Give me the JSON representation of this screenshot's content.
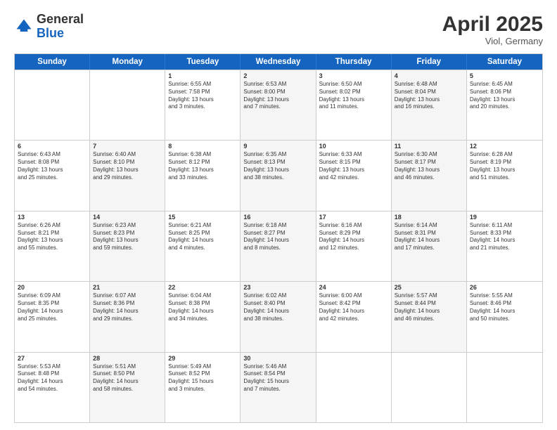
{
  "header": {
    "logo_general": "General",
    "logo_blue": "Blue",
    "title": "April 2025",
    "location": "Viol, Germany"
  },
  "days_of_week": [
    "Sunday",
    "Monday",
    "Tuesday",
    "Wednesday",
    "Thursday",
    "Friday",
    "Saturday"
  ],
  "weeks": [
    [
      {
        "day": "",
        "info": "",
        "shaded": false
      },
      {
        "day": "",
        "info": "",
        "shaded": false
      },
      {
        "day": "1",
        "info": "Sunrise: 6:55 AM\nSunset: 7:58 PM\nDaylight: 13 hours\nand 3 minutes.",
        "shaded": false
      },
      {
        "day": "2",
        "info": "Sunrise: 6:53 AM\nSunset: 8:00 PM\nDaylight: 13 hours\nand 7 minutes.",
        "shaded": true
      },
      {
        "day": "3",
        "info": "Sunrise: 6:50 AM\nSunset: 8:02 PM\nDaylight: 13 hours\nand 11 minutes.",
        "shaded": false
      },
      {
        "day": "4",
        "info": "Sunrise: 6:48 AM\nSunset: 8:04 PM\nDaylight: 13 hours\nand 16 minutes.",
        "shaded": true
      },
      {
        "day": "5",
        "info": "Sunrise: 6:45 AM\nSunset: 8:06 PM\nDaylight: 13 hours\nand 20 minutes.",
        "shaded": false
      }
    ],
    [
      {
        "day": "6",
        "info": "Sunrise: 6:43 AM\nSunset: 8:08 PM\nDaylight: 13 hours\nand 25 minutes.",
        "shaded": false
      },
      {
        "day": "7",
        "info": "Sunrise: 6:40 AM\nSunset: 8:10 PM\nDaylight: 13 hours\nand 29 minutes.",
        "shaded": true
      },
      {
        "day": "8",
        "info": "Sunrise: 6:38 AM\nSunset: 8:12 PM\nDaylight: 13 hours\nand 33 minutes.",
        "shaded": false
      },
      {
        "day": "9",
        "info": "Sunrise: 6:35 AM\nSunset: 8:13 PM\nDaylight: 13 hours\nand 38 minutes.",
        "shaded": true
      },
      {
        "day": "10",
        "info": "Sunrise: 6:33 AM\nSunset: 8:15 PM\nDaylight: 13 hours\nand 42 minutes.",
        "shaded": false
      },
      {
        "day": "11",
        "info": "Sunrise: 6:30 AM\nSunset: 8:17 PM\nDaylight: 13 hours\nand 46 minutes.",
        "shaded": true
      },
      {
        "day": "12",
        "info": "Sunrise: 6:28 AM\nSunset: 8:19 PM\nDaylight: 13 hours\nand 51 minutes.",
        "shaded": false
      }
    ],
    [
      {
        "day": "13",
        "info": "Sunrise: 6:26 AM\nSunset: 8:21 PM\nDaylight: 13 hours\nand 55 minutes.",
        "shaded": false
      },
      {
        "day": "14",
        "info": "Sunrise: 6:23 AM\nSunset: 8:23 PM\nDaylight: 13 hours\nand 59 minutes.",
        "shaded": true
      },
      {
        "day": "15",
        "info": "Sunrise: 6:21 AM\nSunset: 8:25 PM\nDaylight: 14 hours\nand 4 minutes.",
        "shaded": false
      },
      {
        "day": "16",
        "info": "Sunrise: 6:18 AM\nSunset: 8:27 PM\nDaylight: 14 hours\nand 8 minutes.",
        "shaded": true
      },
      {
        "day": "17",
        "info": "Sunrise: 6:16 AM\nSunset: 8:29 PM\nDaylight: 14 hours\nand 12 minutes.",
        "shaded": false
      },
      {
        "day": "18",
        "info": "Sunrise: 6:14 AM\nSunset: 8:31 PM\nDaylight: 14 hours\nand 17 minutes.",
        "shaded": true
      },
      {
        "day": "19",
        "info": "Sunrise: 6:11 AM\nSunset: 8:33 PM\nDaylight: 14 hours\nand 21 minutes.",
        "shaded": false
      }
    ],
    [
      {
        "day": "20",
        "info": "Sunrise: 6:09 AM\nSunset: 8:35 PM\nDaylight: 14 hours\nand 25 minutes.",
        "shaded": false
      },
      {
        "day": "21",
        "info": "Sunrise: 6:07 AM\nSunset: 8:36 PM\nDaylight: 14 hours\nand 29 minutes.",
        "shaded": true
      },
      {
        "day": "22",
        "info": "Sunrise: 6:04 AM\nSunset: 8:38 PM\nDaylight: 14 hours\nand 34 minutes.",
        "shaded": false
      },
      {
        "day": "23",
        "info": "Sunrise: 6:02 AM\nSunset: 8:40 PM\nDaylight: 14 hours\nand 38 minutes.",
        "shaded": true
      },
      {
        "day": "24",
        "info": "Sunrise: 6:00 AM\nSunset: 8:42 PM\nDaylight: 14 hours\nand 42 minutes.",
        "shaded": false
      },
      {
        "day": "25",
        "info": "Sunrise: 5:57 AM\nSunset: 8:44 PM\nDaylight: 14 hours\nand 46 minutes.",
        "shaded": true
      },
      {
        "day": "26",
        "info": "Sunrise: 5:55 AM\nSunset: 8:46 PM\nDaylight: 14 hours\nand 50 minutes.",
        "shaded": false
      }
    ],
    [
      {
        "day": "27",
        "info": "Sunrise: 5:53 AM\nSunset: 8:48 PM\nDaylight: 14 hours\nand 54 minutes.",
        "shaded": false
      },
      {
        "day": "28",
        "info": "Sunrise: 5:51 AM\nSunset: 8:50 PM\nDaylight: 14 hours\nand 58 minutes.",
        "shaded": true
      },
      {
        "day": "29",
        "info": "Sunrise: 5:49 AM\nSunset: 8:52 PM\nDaylight: 15 hours\nand 3 minutes.",
        "shaded": false
      },
      {
        "day": "30",
        "info": "Sunrise: 5:46 AM\nSunset: 8:54 PM\nDaylight: 15 hours\nand 7 minutes.",
        "shaded": true
      },
      {
        "day": "",
        "info": "",
        "shaded": false
      },
      {
        "day": "",
        "info": "",
        "shaded": false
      },
      {
        "day": "",
        "info": "",
        "shaded": false
      }
    ]
  ]
}
